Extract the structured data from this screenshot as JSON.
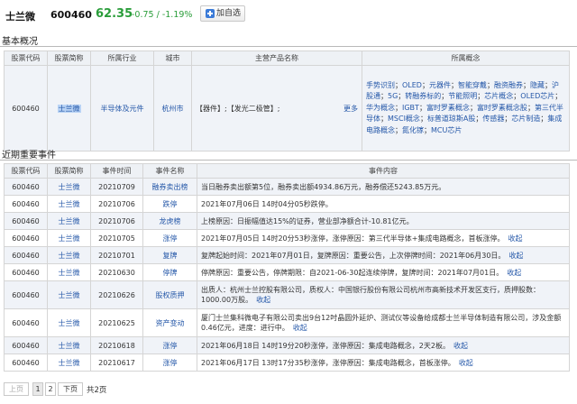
{
  "header": {
    "stock_name": "士兰微",
    "stock_code": "600460",
    "price": "62.35",
    "change": "-0.75 / -1.19%",
    "add_favorite_label": "加自选",
    "up_down_color": "#2a9d3a"
  },
  "basic": {
    "title": "基本概况",
    "headers": [
      "股票代码",
      "股票简称",
      "所属行业",
      "城市",
      "主营产品名称",
      "所属概念"
    ],
    "code": "600460",
    "short_name": "士兰微",
    "industry": "半导体及元件",
    "city": "杭州市",
    "products_text": "【器件】;【发光二极管】;",
    "more_label": "更多",
    "concepts": [
      "手势识别",
      "OLED",
      "元器件",
      "智能穿戴",
      "融资融券",
      "隐藏",
      "沪股通",
      "5G",
      "转融券标的",
      "节能照明",
      "芯片概念",
      "OLED芯片",
      "华为概念",
      "IGBT",
      "富时罗素概念",
      "富时罗素概念股",
      "第三代半导体",
      "MSCI概念",
      "标普道琼斯A股",
      "传感器",
      "芯片制造",
      "集成电路概念",
      "氮化镓",
      "MCU芯片"
    ]
  },
  "events": {
    "title": "近期重要事件",
    "headers": [
      "股票代码",
      "股票简称",
      "事件时间",
      "事件名称",
      "事件内容"
    ],
    "fold_label": "收起",
    "rows": [
      {
        "code": "600460",
        "name": "士兰微",
        "date": "20210709",
        "event": "融券卖出榜",
        "content": "当日融券卖出额第5位，融券卖出额4934.86万元，融券偿还5243.85万元。",
        "fold": false
      },
      {
        "code": "600460",
        "name": "士兰微",
        "date": "20210706",
        "event": "跌停",
        "content": "2021年07月06日 14时04分05秒跌停。",
        "fold": false
      },
      {
        "code": "600460",
        "name": "士兰微",
        "date": "20210706",
        "event": "龙虎榜",
        "content": "上榜原因：日振幅值达15%的证券，营业部净额合计-10.81亿元。",
        "fold": false
      },
      {
        "code": "600460",
        "name": "士兰微",
        "date": "20210705",
        "event": "涨停",
        "content": "2021年07月05日 14时20分53秒涨停，涨停原因：第三代半导体+集成电路概念，首板涨停。",
        "fold": true
      },
      {
        "code": "600460",
        "name": "士兰微",
        "date": "20210701",
        "event": "复牌",
        "content": "复牌起始时间：2021年07月01日，复牌原因：重要公告，上次停牌时间：2021年06月30日。",
        "fold": true
      },
      {
        "code": "600460",
        "name": "士兰微",
        "date": "20210630",
        "event": "停牌",
        "content": "停牌原因：重要公告，停牌期限：自2021-06-30起连续停牌，复牌时间：2021年07月01日。",
        "fold": true
      },
      {
        "code": "600460",
        "name": "士兰微",
        "date": "20210626",
        "event": "股权质押",
        "content": "出质人：杭州士兰控股有限公司，质权人：中国银行股份有限公司杭州市高新技术开发区支行，质押股数：1000.00万股。",
        "fold": true
      },
      {
        "code": "600460",
        "name": "士兰微",
        "date": "20210625",
        "event": "资产变动",
        "content": "厦门士兰集科微电子有限公司卖出9台12吋晶圆外延炉、测试仪等设备给成都士兰半导体制造有限公司，涉及金额0.46亿元，进度：进行中。",
        "fold": true
      },
      {
        "code": "600460",
        "name": "士兰微",
        "date": "20210618",
        "event": "涨停",
        "content": "2021年06月18日 14时19分20秒涨停，涨停原因：集成电路概念，2天2板。",
        "fold": true
      },
      {
        "code": "600460",
        "name": "士兰微",
        "date": "20210617",
        "event": "涨停",
        "content": "2021年06月17日 13时17分35秒涨停，涨停原因：集成电路概念，首板涨停。",
        "fold": true
      }
    ]
  },
  "pager": {
    "prev_label": "上页",
    "pages": [
      "1",
      "2"
    ],
    "next_label": "下页",
    "total_label": "共2页"
  }
}
